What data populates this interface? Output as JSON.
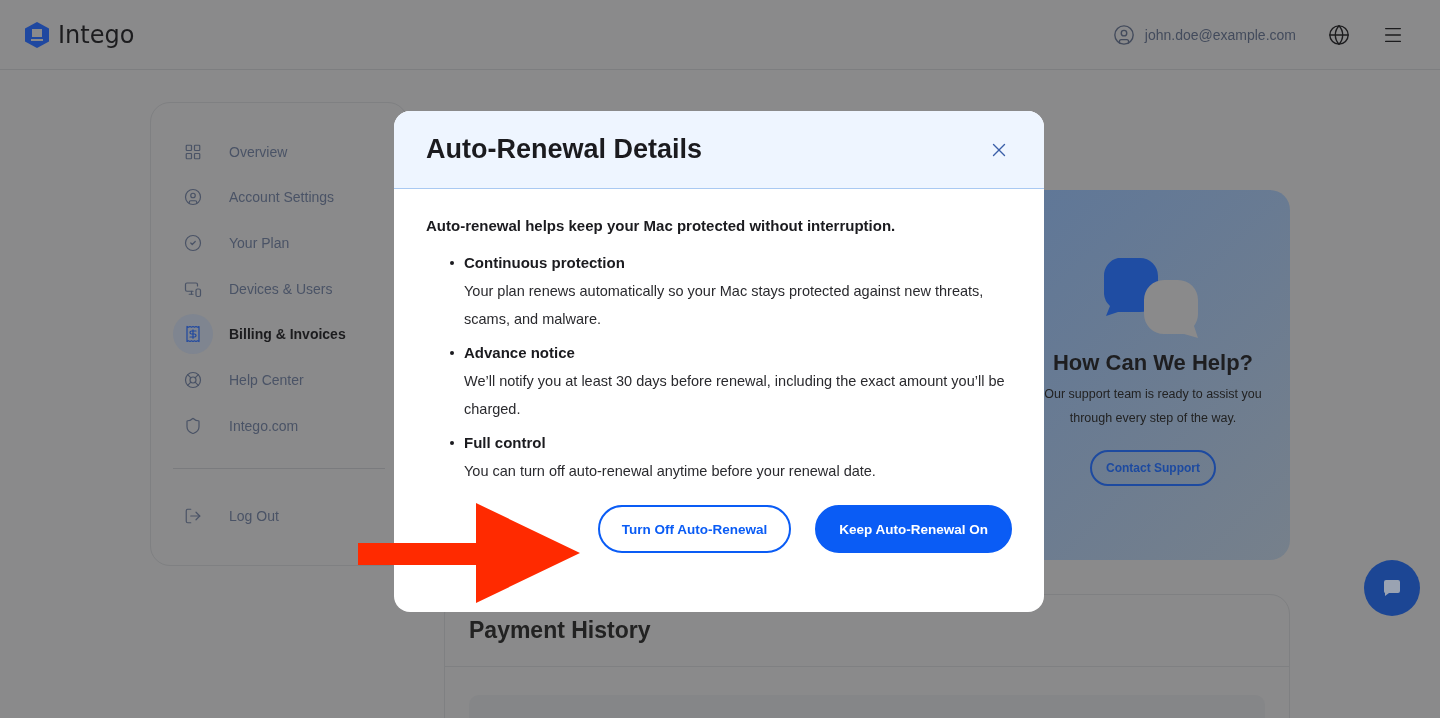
{
  "header": {
    "logo": "Intego",
    "email": "john.doe@example.com"
  },
  "sidebar": {
    "items": [
      {
        "label": "Overview",
        "selected": false
      },
      {
        "label": "Account Settings",
        "selected": false
      },
      {
        "label": "Your Plan",
        "selected": false
      },
      {
        "label": "Devices & Users",
        "selected": false
      },
      {
        "label": "Billing & Invoices",
        "selected": true
      },
      {
        "label": "Help Center",
        "selected": false
      },
      {
        "label": "Intego.com",
        "selected": false
      }
    ],
    "logout": "Log Out"
  },
  "help_card": {
    "title": "How Can We Help?",
    "text": "Our support team is ready to assist you through every step of the way.",
    "button": "Contact Support"
  },
  "payment_history": {
    "title": "Payment History"
  },
  "dialog": {
    "title": "Auto-Renewal Details",
    "intro": "Auto-renewal helps keep your Mac protected without interruption.",
    "points": [
      {
        "title": "Continuous protection",
        "text": "Your plan renews automatically so your Mac stays protected against new threats, scams, and malware."
      },
      {
        "title": "Advance notice",
        "text": "We’ll notify you at least 30 days before renewal, including the exact amount you’ll be charged."
      },
      {
        "title": "Full control",
        "text": "You can turn off auto-renewal anytime before your renewal date."
      }
    ],
    "buttons": [
      {
        "label": "Turn Off Auto-Renewal",
        "kind": "secondary"
      },
      {
        "label": "Keep Auto-Renewal On",
        "kind": "primary"
      }
    ]
  }
}
